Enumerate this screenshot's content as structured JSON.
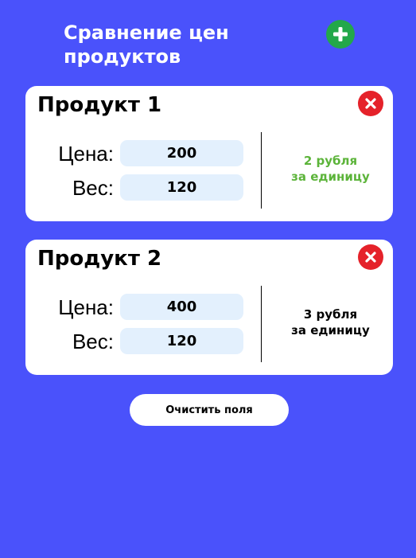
{
  "header": {
    "title_line1": "Сравнение цен",
    "title_line2": "продуктов",
    "add_icon": "plus-icon"
  },
  "products": [
    {
      "title": "Продукт 1",
      "price_label": "Цена:",
      "price_value": "200",
      "weight_label": "Вес:",
      "weight_value": "120",
      "result_line1": "2 рубля",
      "result_line2": "за единицу",
      "result_color": "#5cb43a",
      "remove_icon": "close-icon"
    },
    {
      "title": "Продукт 2",
      "price_label": "Цена:",
      "price_value": "400",
      "weight_label": "Вес:",
      "weight_value": "120",
      "result_line1": "3 рубля",
      "result_line2": "за единицу",
      "result_color": "#000000",
      "remove_icon": "close-icon"
    }
  ],
  "clear_button": {
    "label": "Очистить поля"
  },
  "colors": {
    "background": "#4a52fb",
    "add_button": "#23a84a",
    "remove_button": "#e5222a",
    "input_background": "#e3f0fd",
    "best_price": "#5cb43a"
  }
}
